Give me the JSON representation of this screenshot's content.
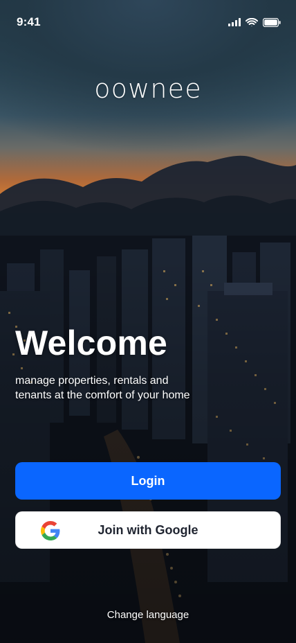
{
  "status_bar": {
    "time": "9:41",
    "icons": [
      "signal-icon",
      "wifi-icon",
      "battery-icon"
    ]
  },
  "brand": {
    "logo_text": "oownee"
  },
  "hero": {
    "title": "Welcome",
    "subtitle": "manage properties, rentals and tenants at the comfort of your home"
  },
  "actions": {
    "login_label": "Login",
    "google_label": "Join with Google",
    "change_language_label": "Change language"
  },
  "colors": {
    "primary": "#0a66ff",
    "text_on_primary": "#ffffff",
    "google_button_bg": "#ffffff",
    "google_button_text": "#1f2430"
  }
}
